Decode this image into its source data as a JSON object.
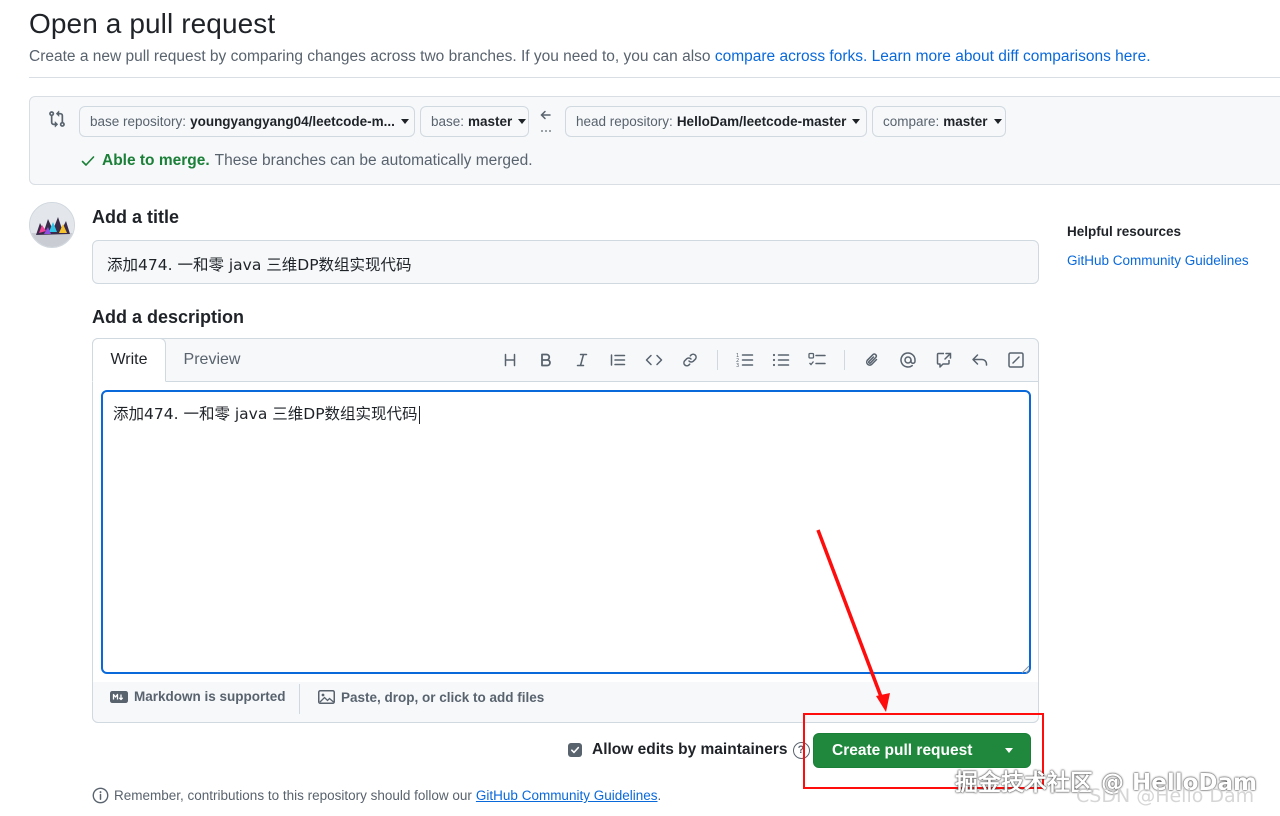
{
  "header": {
    "title": "Open a pull request",
    "subtitle_prefix": "Create a new pull request by comparing changes across two branches. If you need to, you can also ",
    "subtitle_link1": "compare across forks.",
    "subtitle_link2": "Learn more about diff comparisons here."
  },
  "compare": {
    "base_repo_prefix": "base repository:",
    "base_repo_value": "youngyangyang04/leetcode-m...",
    "base_prefix": "base:",
    "base_value": "master",
    "head_repo_prefix": "head repository:",
    "head_repo_value": "HelloDam/leetcode-master",
    "compare_prefix": "compare:",
    "compare_value": "master",
    "merge_ok": "Able to merge.",
    "merge_text": "These branches can be automatically merged."
  },
  "form": {
    "title_label": "Add a title",
    "title_value": "添加474. 一和零 java 三维DP数组实现代码",
    "description_label": "Add a description",
    "tab_write": "Write",
    "tab_preview": "Preview",
    "description_value": "添加474. 一和零 java 三维DP数组实现代码",
    "markdown_note": "Markdown is supported",
    "attach_note": "Paste, drop, or click to add files",
    "allow_edits": "Allow edits by maintainers",
    "create_button": "Create pull request",
    "remember_prefix": "Remember, contributions to this repository should follow our",
    "remember_link": "GitHub Community Guidelines",
    "remember_suffix": "."
  },
  "sidebar": {
    "heading": "Helpful resources",
    "link": "GitHub Community Guidelines"
  },
  "watermark": {
    "juejin": "掘金技术社区 @ HelloDam",
    "csdn": "CSDN @Hello Dam"
  },
  "colors": {
    "primary_button": "#1f883d",
    "link": "#0969da",
    "success": "#1a7f37",
    "annotation": "#ff0d0d"
  }
}
